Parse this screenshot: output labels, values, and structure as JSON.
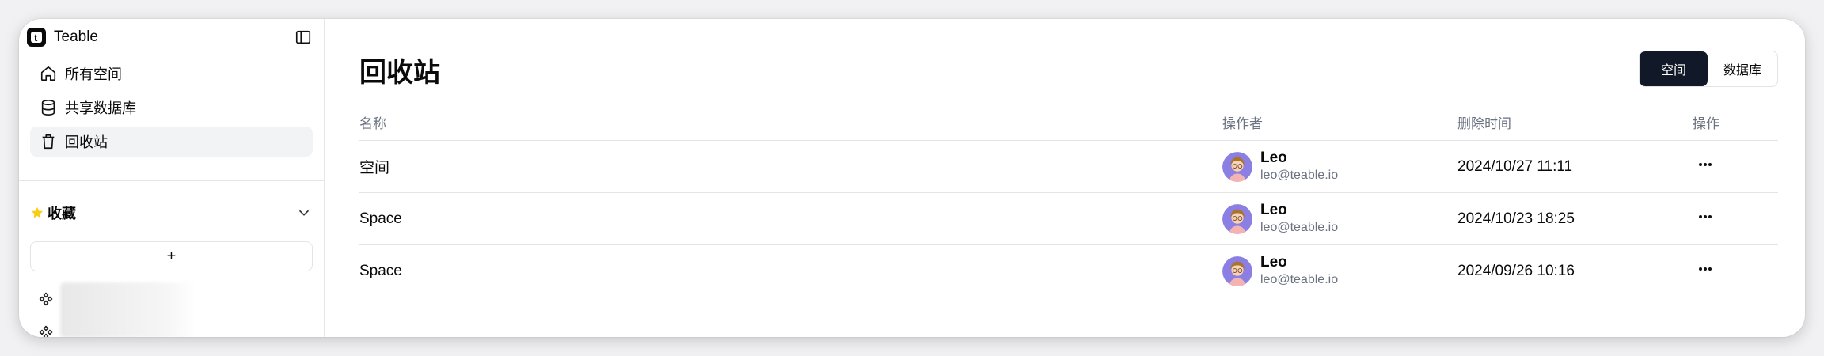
{
  "app": {
    "name": "Teable"
  },
  "sidebar": {
    "items": [
      {
        "label": "所有空间",
        "icon": "home-icon"
      },
      {
        "label": "共享数据库",
        "icon": "database-icon"
      },
      {
        "label": "回收站",
        "icon": "trash-icon",
        "active": true
      }
    ],
    "favorites": {
      "label": "收藏",
      "add_label": "+"
    }
  },
  "main": {
    "title": "回收站",
    "toggle": {
      "space_label": "空间",
      "base_label": "数据库",
      "selected": "空间"
    },
    "table": {
      "headers": [
        "名称",
        "操作者",
        "删除时间",
        "操作"
      ],
      "rows": [
        {
          "name": "空间",
          "operator_name": "Leo",
          "operator_email": "leo@teable.io",
          "deleted_at": "2024/10/27 11:11"
        },
        {
          "name": "Space",
          "operator_name": "Leo",
          "operator_email": "leo@teable.io",
          "deleted_at": "2024/10/23 18:25"
        },
        {
          "name": "Space",
          "operator_name": "Leo",
          "operator_email": "leo@teable.io",
          "deleted_at": "2024/09/26 10:16"
        }
      ]
    }
  },
  "colors": {
    "accent_dark": "#111827",
    "active_bg": "#f2f3f5",
    "star": "#facc15",
    "avatar_bg": "#8b7fe3"
  }
}
